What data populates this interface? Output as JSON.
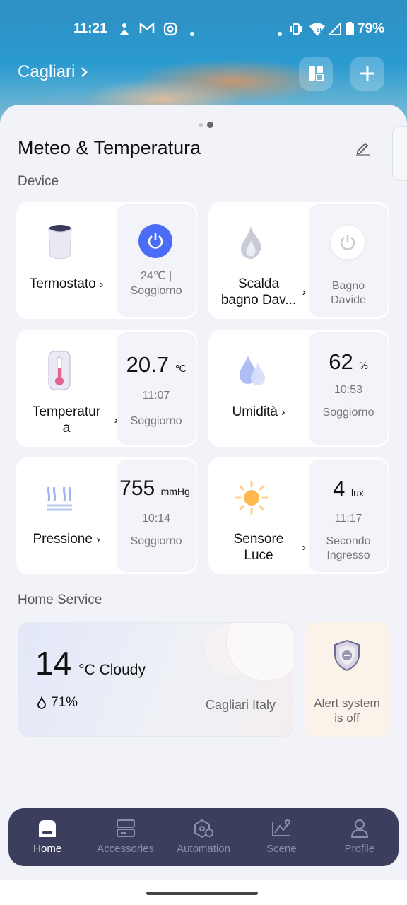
{
  "status_bar": {
    "time": "11:21",
    "network": "6E",
    "battery": "79%"
  },
  "header": {
    "location": "Cagliari",
    "layout_icon": "dashboard-layout-icon",
    "add_icon": "plus-icon"
  },
  "page": {
    "title": "Meteo & Temperatura",
    "edit_icon": "pencil-icon"
  },
  "sections": {
    "device": "Device",
    "home_service": "Home Service"
  },
  "devices": [
    {
      "name": "Termostato",
      "right_line1": "24℃ |",
      "right_line2": "Soggiorno",
      "power": "on"
    },
    {
      "name_line1": "Scalda",
      "name_line2": "bagno Dav...",
      "right_line1": "Bagno",
      "right_line2": "Davide",
      "power": "off"
    },
    {
      "name_line1": "Temperatur",
      "name_line2": "a",
      "value": "20.7",
      "unit": "℃",
      "time": "11:07",
      "room": "Soggiorno"
    },
    {
      "name": "Umidità",
      "value": "62",
      "unit": "%",
      "time": "10:53",
      "room": "Soggiorno"
    },
    {
      "name": "Pressione",
      "value": "755",
      "unit": "mmHg",
      "time": "10:14",
      "room": "Soggiorno"
    },
    {
      "name_line1": "Sensore",
      "name_line2": "Luce",
      "value": "4",
      "unit": "lux",
      "time": "11:17",
      "room_line1": "Secondo",
      "room_line2": "Ingresso"
    }
  ],
  "weather": {
    "temp": "14",
    "unit_cond": "°C Cloudy",
    "humidity": "71%",
    "location": "Cagliari Italy"
  },
  "alert": {
    "line1": "Alert system",
    "line2": "is off"
  },
  "nav": [
    {
      "label": "Home",
      "active": true
    },
    {
      "label": "Accessories"
    },
    {
      "label": "Automation"
    },
    {
      "label": "Scene"
    },
    {
      "label": "Profile"
    }
  ],
  "colors": {
    "accent": "#4a6cf7",
    "nav_bg": "#3c3e5e"
  }
}
